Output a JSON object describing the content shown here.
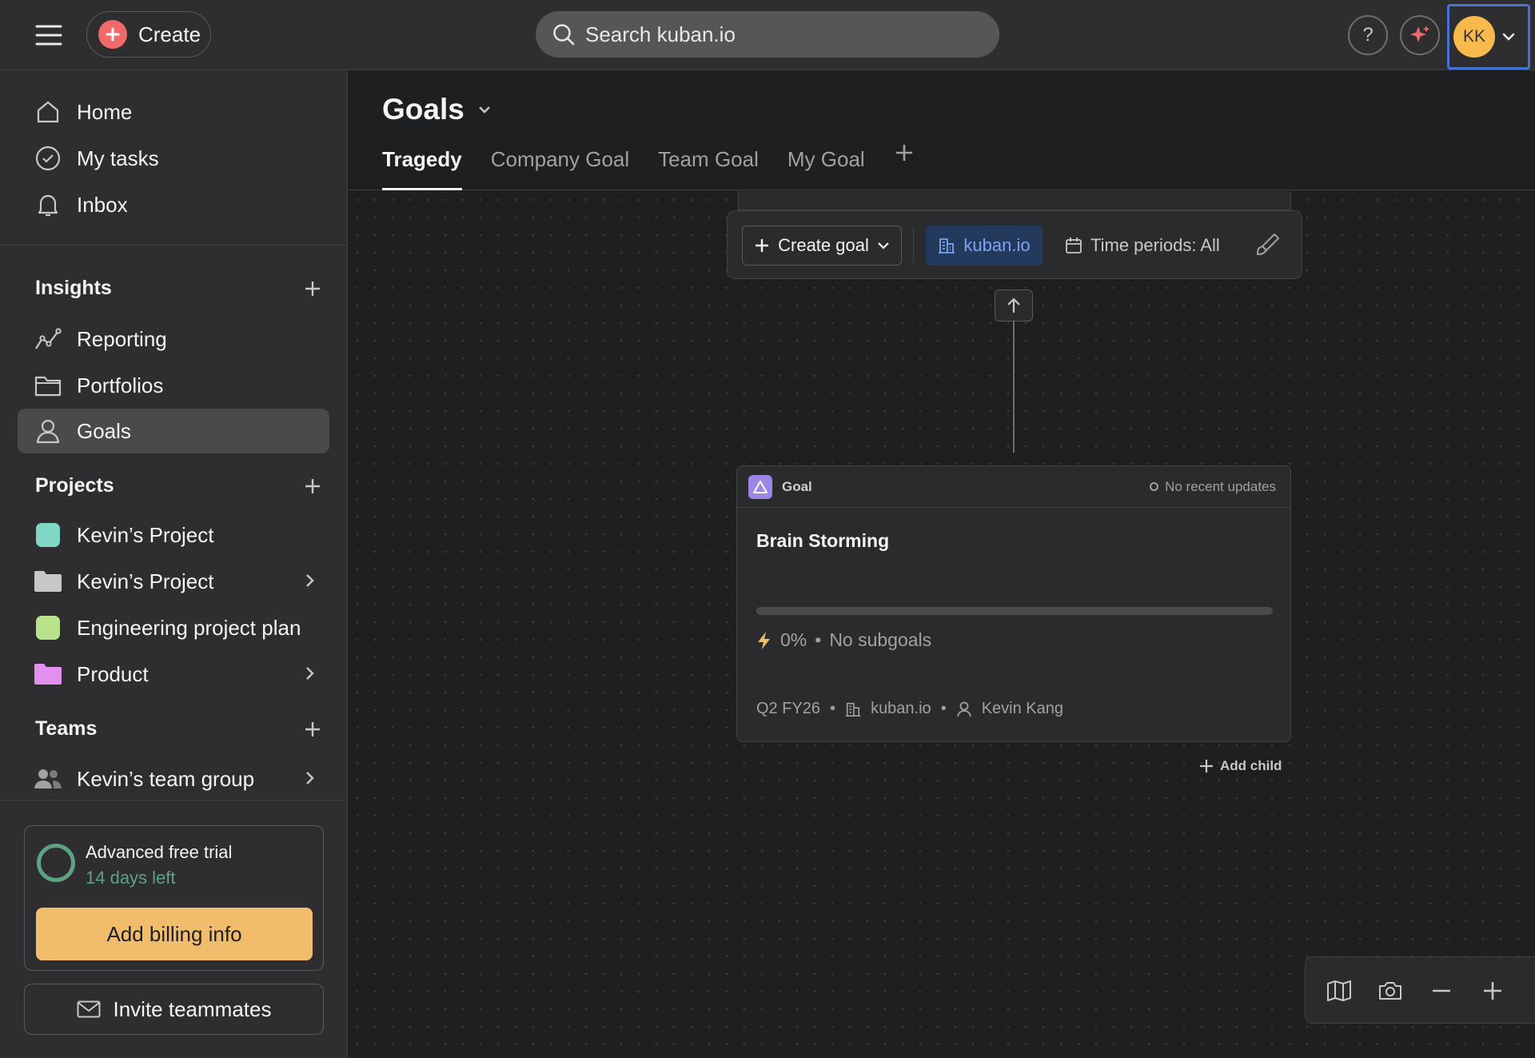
{
  "topbar": {
    "create_label": "Create",
    "search_placeholder": "Search kuban.io",
    "help_label": "?",
    "avatar_initials": "KK"
  },
  "sidebar": {
    "nav": [
      {
        "label": "Home",
        "icon": "home-icon"
      },
      {
        "label": "My tasks",
        "icon": "check-circle-icon"
      },
      {
        "label": "Inbox",
        "icon": "bell-icon"
      }
    ],
    "insights": {
      "title": "Insights",
      "items": [
        {
          "label": "Reporting",
          "icon": "chart-line-icon"
        },
        {
          "label": "Portfolios",
          "icon": "folder-icon"
        },
        {
          "label": "Goals",
          "icon": "person-icon",
          "active": true
        }
      ]
    },
    "projects": {
      "title": "Projects",
      "items": [
        {
          "label": "Kevin’s Project",
          "color": "#7fd7c4"
        },
        {
          "label": "Kevin’s Project",
          "color": "#c8c8c8"
        },
        {
          "label": "Engineering project plan",
          "color": "#b9e38b"
        },
        {
          "label": "Product",
          "color": "#e28ff0"
        }
      ]
    },
    "teams": {
      "title": "Teams",
      "items": [
        {
          "label": "Kevin’s team group"
        }
      ]
    },
    "trial": {
      "title": "Advanced free trial",
      "days_left": "14 days left",
      "billing_label": "Add billing info"
    },
    "invite_label": "Invite teammates"
  },
  "main": {
    "title": "Goals",
    "tabs": [
      {
        "label": "Tragedy",
        "active": true
      },
      {
        "label": "Company Goal"
      },
      {
        "label": "Team Goal"
      },
      {
        "label": "My Goal"
      }
    ],
    "toolbar": {
      "create_goal": "Create goal",
      "workspace": "kuban.io",
      "time_periods": "Time periods: All"
    },
    "goal_card": {
      "type": "Goal",
      "status": "No recent updates",
      "title": "Brain Storming",
      "progress_text": "0%",
      "progress_fraction": 0,
      "subgoals": "No subgoals",
      "period": "Q2 FY26",
      "workspace": "kuban.io",
      "owner": "Kevin Kang"
    },
    "add_child_label": "Add child"
  },
  "colors": {
    "accent_red": "#f06a6a",
    "goal_purple": "#9b86e6",
    "trial_green": "#5da283",
    "billing_orange": "#f1bd6c",
    "focus_blue": "#4573d2"
  }
}
